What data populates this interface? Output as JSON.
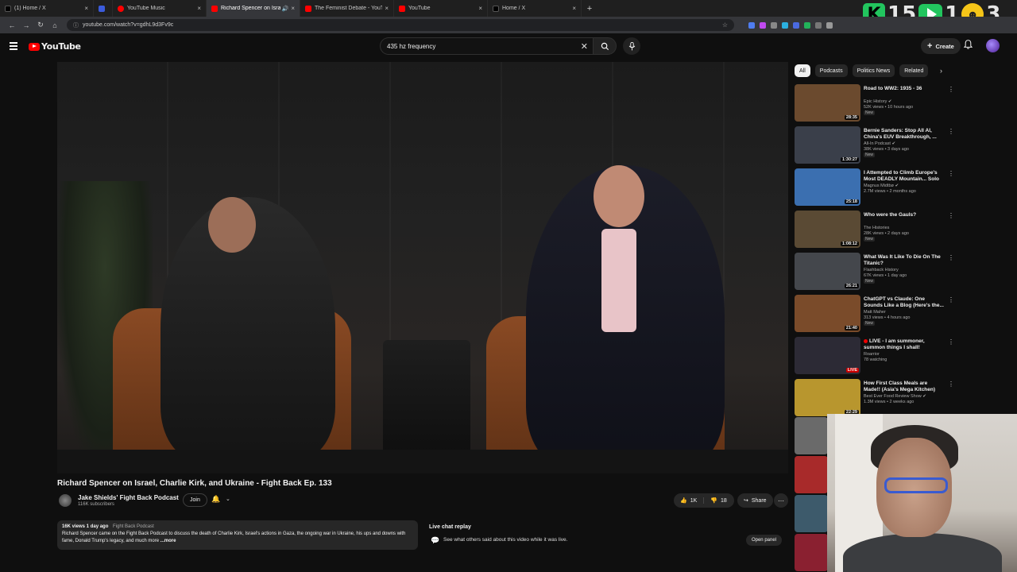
{
  "browser": {
    "tabs": [
      {
        "title": "(1) Home / X",
        "favicon_color": "#000000",
        "close": "×",
        "active": false
      },
      {
        "title": "",
        "favicon_color": "#3b5bdb",
        "close": "",
        "active": false
      },
      {
        "title": "YouTube Music",
        "favicon_color": "#ff0000",
        "close": "×",
        "active": false
      },
      {
        "title": "Richard Spencer on Israel, C",
        "favicon_color": "#ff0000",
        "close": "×",
        "active": true,
        "audio": "🔊"
      },
      {
        "title": "The Feminist Debate - YouTube",
        "favicon_color": "#ff0000",
        "close": "×",
        "active": false
      },
      {
        "title": "YouTube",
        "favicon_color": "#ff0000",
        "close": "×",
        "active": false
      },
      {
        "title": "Home / X",
        "favicon_color": "#000000",
        "close": "×",
        "active": false
      }
    ],
    "new_tab": "+",
    "url": "youtube.com/watch?v=gdhL9d3Fv9c",
    "overlay": {
      "num1": "15",
      "num2": "1",
      "num3": "3"
    }
  },
  "header": {
    "logo_text": "YouTube",
    "search_value": "435 hz frequency",
    "search_clear": "✕",
    "create_label": "Create",
    "create_plus": "+"
  },
  "video": {
    "title": "Richard Spencer on Israel, Charlie Kirk, and Ukraine - Fight Back Ep. 133",
    "channel_name": "Jake Shields' Fight Back Podcast",
    "subscribers": "116K subscribers",
    "join_label": "Join",
    "likes": "1K",
    "dislikes": "18",
    "share_label": "Share",
    "more_label": "⋯",
    "description": {
      "stats": "16K views  1 day ago",
      "tag": "Fight Back Podcast",
      "text": "Richard Spencer came on the Fight Back Podcast to discuss the death of Charlie Kirk, Israel's actions in Gaza, the ongoing war in Ukraine, his ups and downs with fame, Donald Trump's legacy, and much more",
      "more": "...more"
    },
    "live_chat": {
      "title": "Live chat replay",
      "text": "See what others said about this video while it was live.",
      "open_label": "Open panel"
    }
  },
  "sidebar": {
    "chips": [
      "All",
      "Podcasts",
      "Politics News",
      "Related"
    ],
    "chip_next": "›",
    "recommendations": [
      {
        "title": "Road to WW2: 1935 - 36",
        "channel": "Epic History",
        "verified": true,
        "meta": "52K views • 10 hours ago",
        "badge": "New",
        "duration": "28:35",
        "thumb_color": "#6b4a2e"
      },
      {
        "title": "Bernie Sanders: Stop All AI, China's EUV Breakthrough, ...",
        "channel": "All-In Podcast",
        "verified": true,
        "meta": "38K views • 3 days ago",
        "badge": "New",
        "duration": "1:30:27",
        "thumb_color": "#3a3f4a"
      },
      {
        "title": "I Attempted to Climb Europe's Most DEADLY Mountain... Solo",
        "channel": "Magnus Midtbø",
        "verified": true,
        "meta": "2.7M views • 2 months ago",
        "badge": "",
        "duration": "25:18",
        "thumb_color": "#3b6fb0"
      },
      {
        "title": "Who were the Gauls?",
        "channel": "The Histories",
        "verified": false,
        "meta": "28K views • 2 days ago",
        "badge": "New",
        "duration": "1:08:12",
        "thumb_color": "#5a4a34"
      },
      {
        "title": "What Was It Like To Die On The Titanic?",
        "channel": "Flashback History",
        "verified": false,
        "meta": "67K views • 1 day ago",
        "badge": "New",
        "duration": "26:21",
        "thumb_color": "#44474c"
      },
      {
        "title": "ChatGPT vs Claude: One Sounds Like a Blog (Here's the...",
        "channel": "Matt Maher",
        "verified": false,
        "meta": "313 views • 4 hours ago",
        "badge": "New",
        "duration": "21:40",
        "thumb_color": "#7a4b2a"
      },
      {
        "title": "LIVE - I am summoner, summon things I shall!",
        "channel": "Roarrior",
        "verified": false,
        "meta": "78 watching",
        "badge": "",
        "duration": "LIVE",
        "live": true,
        "thumb_color": "#2c2a35"
      },
      {
        "title": "How First Class Meals are Made!! (Asia's Mega Kitchen)",
        "channel": "Best Ever Food Review Show",
        "verified": true,
        "meta": "1.3M views • 2 weeks ago",
        "badge": "",
        "duration": "22:29",
        "thumb_color": "#b8962e"
      }
    ],
    "extra_thumb_colors": [
      "#6a6a6a",
      "#a82a2a",
      "#3d5a6b",
      "#8a2030"
    ],
    "dots": "⋮"
  },
  "icons": {
    "back": "←",
    "forward": "→",
    "reload": "↻",
    "home": "⌂",
    "info": "ⓘ",
    "search": "🔍",
    "mic": "🎤",
    "bell": "🔔",
    "like": "👍",
    "dislike": "👎",
    "share": "↪",
    "chat": "💬",
    "sub_bell": "🔔",
    "chevron": "⌄",
    "star": "☆"
  }
}
